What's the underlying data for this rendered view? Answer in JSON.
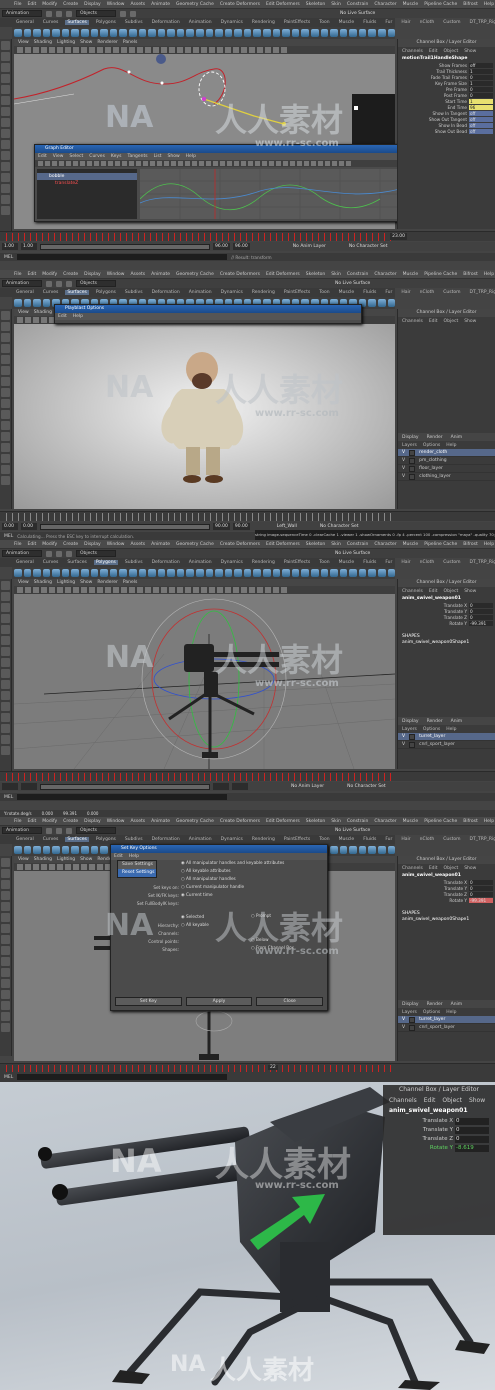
{
  "menu": [
    "File",
    "Edit",
    "Modify",
    "Create",
    "Display",
    "Window",
    "Assets",
    "Animate",
    "Geometry Cache",
    "Create Deformers",
    "Edit Deformers",
    "Skeleton",
    "Skin",
    "Constrain",
    "Character",
    "Muscle",
    "Pipeline Cache",
    "Bifrost",
    "Help"
  ],
  "mode_dropdown": "Animation",
  "objects_dropdown": "Objects",
  "no_live_surface": "No Live Surface",
  "shelf_tabs": [
    "General",
    "Curves",
    "Surfaces",
    "Polygons",
    "Subdivs",
    "Deformation",
    "Animation",
    "Dynamics",
    "Rendering",
    "PaintEffects",
    "Toon",
    "Muscle",
    "Fluids",
    "Fur",
    "Hair",
    "nCloth",
    "Custom",
    "DT_TRP_Rigging"
  ],
  "viewport_menu": [
    "View",
    "Shading",
    "Lighting",
    "Show",
    "Renderer",
    "Panels"
  ],
  "channel_box_title": "Channel Box / Layer Editor",
  "channel_box_menu": [
    "Channels",
    "Edit",
    "Object",
    "Show"
  ],
  "layer_tabs": [
    "Display",
    "Render",
    "Anim"
  ],
  "layer_menu": [
    "Layers",
    "Options",
    "Help"
  ],
  "panel1": {
    "object_name": "motionTrail1HandleShape",
    "attributes": [
      {
        "label": "Show Frames",
        "value": "off"
      },
      {
        "label": "Trail Thickness",
        "value": "1"
      },
      {
        "label": "Fade Trail Frames",
        "value": "0"
      },
      {
        "label": "Key Frame Size",
        "value": "1"
      },
      {
        "label": "Pre Frame",
        "value": "0"
      },
      {
        "label": "Post Frame",
        "value": "0"
      },
      {
        "label": "Start Time",
        "value": "1"
      },
      {
        "label": "End Time",
        "value": "96"
      },
      {
        "label": "Show In Tangent",
        "value": "off"
      },
      {
        "label": "Show Out Tangent",
        "value": "off"
      },
      {
        "label": "Show In Bead",
        "value": "off"
      },
      {
        "label": "Show Out Bead",
        "value": "off"
      }
    ],
    "graph_editor": {
      "title": "Graph Editor",
      "menu": [
        "Edit",
        "View",
        "Select",
        "Curves",
        "Keys",
        "Tangents",
        "List",
        "Show",
        "Help"
      ],
      "outliner_items": [
        "bobble",
        "translateZ"
      ]
    },
    "range_start": "1.00",
    "range_end": "96.00",
    "frame": "23.00",
    "no_anim_layer": "No Anim Layer",
    "no_character_set": "No Character Set",
    "mel": "MEL",
    "result": "// Result: transform"
  },
  "panel2": {
    "playblast_title": "Playblast Options",
    "playblast_menu": [
      "Edit",
      "Help"
    ],
    "layers": [
      "render_cloth",
      "pm_clothing",
      "floor_layer",
      "clothing_layer"
    ],
    "range_start": "0.00",
    "range_end": "90.00",
    "range_end2": "90.00",
    "layer_label": "Left_Wall",
    "no_character_set": "No Character Set",
    "mel": "MEL",
    "command": "Calculating... Press the ESC key to interrupt calculation.",
    "result": "string image-sequenceTime 0 -clearCache 1 -viewer 1 -showOrnaments 0 -fp 4 -percent 100 -compression \"maya\" -quality 70;"
  },
  "panel3": {
    "object_name": "anim_swivel_weapon01",
    "attributes": [
      {
        "label": "Translate X",
        "value": "0"
      },
      {
        "label": "Translate Y",
        "value": "0"
      },
      {
        "label": "Translate Z",
        "value": "0"
      },
      {
        "label": "Rotate Y",
        "value": "-99.391"
      }
    ],
    "shapes_label": "SHAPES",
    "shape_name": "anim_swivel_weapon0Shape1",
    "layers": [
      "turret_layer",
      "cnrl_sport_layer"
    ],
    "ruler_labels": [
      "Y:rotate.deg/s",
      "0.000",
      "99.391",
      "0.000"
    ],
    "no_anim_layer": "No Anim Layer",
    "no_character_set": "No Character Set",
    "mel": "MEL"
  },
  "panel4": {
    "dialog_title": "Set Key Options",
    "dialog_menu": [
      "Edit",
      "Help"
    ],
    "edit_menu_items": [
      "Save Settings",
      "Reset Settings"
    ],
    "option_labels": [
      "Set keys on:",
      "Set IK/FK keys:",
      "Set FullBodyIK keys:",
      "Hierarchy:",
      "Channels:",
      "Control points:",
      "Shapes:"
    ],
    "options_col1": [
      "All manipulator handles and keyable attributes",
      "All keyable attributes",
      "All manipulator handles",
      "Current manipulator handle",
      "Current time",
      "Selected",
      "All keyable"
    ],
    "options_col2": [
      "Prompt",
      "Below",
      "From Channel Box"
    ],
    "buttons": [
      "Set Key",
      "Apply",
      "Close"
    ],
    "object_name": "anim_swivel_weapon01",
    "attributes": [
      {
        "label": "Translate X",
        "value": "0"
      },
      {
        "label": "Translate Y",
        "value": "0"
      },
      {
        "label": "Translate Z",
        "value": "0"
      },
      {
        "label": "Rotate Y",
        "value": "-99.391"
      }
    ],
    "shapes_label": "SHAPES",
    "shape_name": "anim_swivel_weapon0Shape1",
    "layers": [
      "turret_layer",
      "cnrl_sport_layer"
    ],
    "ruler_labels": [
      "Y:rotate.deg/s",
      "0.000",
      "99.391",
      "0.000"
    ],
    "frame": "22",
    "no_anim_layer": "No Anim Layer",
    "no_character_set": "No Character Set",
    "mel": "MEL"
  },
  "panel5": {
    "title": "Channel Box / Layer Editor",
    "menu": [
      "Channels",
      "Edit",
      "Object",
      "Show"
    ],
    "object_name": "anim_swivel_weapon01",
    "attributes": [
      {
        "label": "Translate X",
        "value": "0"
      },
      {
        "label": "Translate Y",
        "value": "0"
      },
      {
        "label": "Translate Z",
        "value": "0"
      },
      {
        "label": "Rotate Y",
        "value": "-8.619"
      }
    ]
  },
  "watermark": {
    "cn": "人人素材",
    "url": "www.rr-sc.com"
  },
  "colors": {
    "accent_blue": "#2a66b5",
    "key_red": "#cc2222",
    "highlight_yellow": "#e8e070",
    "keyed_pink": "#d06060",
    "rotate_green": "#5fd25f"
  }
}
